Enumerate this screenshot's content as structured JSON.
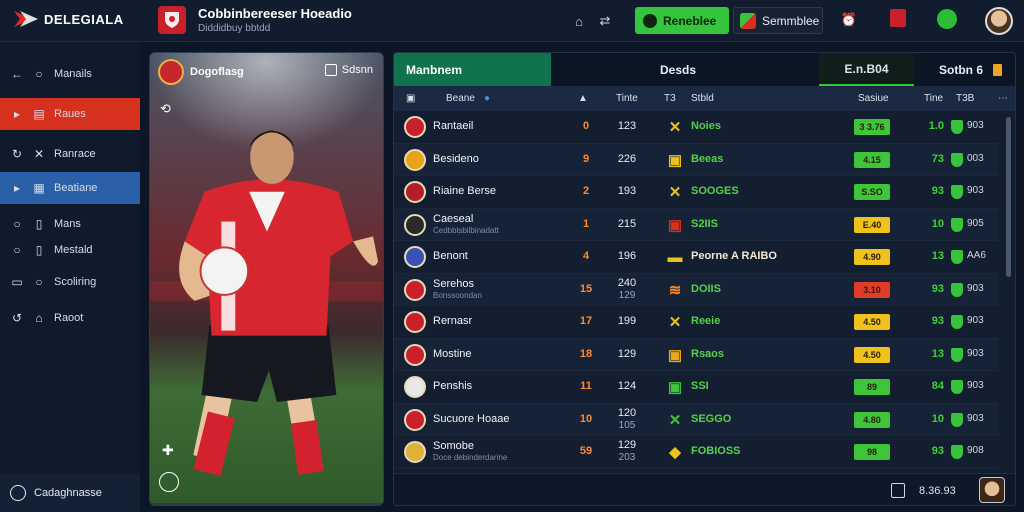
{
  "app": {
    "brand": "DELEGIALA",
    "club_title": "Cobbinbereeser Hoeadio",
    "club_subtitle": "Diddidbuy bbtdd"
  },
  "topbar": {
    "primary_button": "Reneblee",
    "secondary_button": "Semmblee"
  },
  "sidebar": {
    "items": [
      {
        "label": "Manails",
        "icon": "search-icon"
      },
      {
        "label": "Raues",
        "icon": "list-icon"
      },
      {
        "label": "Ranrace",
        "icon": "tools-icon"
      },
      {
        "label": "Beatiane",
        "icon": "calendar-icon"
      },
      {
        "label": "Mans",
        "icon": "doc-icon"
      },
      {
        "label": "Mestald",
        "icon": "doc-icon"
      },
      {
        "label": "Scoliring",
        "icon": "search-icon"
      },
      {
        "label": "Raoot",
        "icon": "tag-icon"
      }
    ],
    "footer": "Cadaghnasse"
  },
  "player_card": {
    "header_name": "Dogoflasg",
    "button": "Sdsnn"
  },
  "panel": {
    "tab_active": "Manbnem",
    "tab_mid": "Desds",
    "tab_score": "E.n.B04",
    "tab_sort": "Sotbn 6",
    "headers": {
      "team": "Beane",
      "pos": "Aa",
      "pts": "Tinte",
      "c1": "T3",
      "result": "Stbld",
      "form": "Sasiue",
      "gd": "Tine",
      "last": "T3B"
    },
    "rows": [
      {
        "team": "Rantaeil",
        "pos": "0",
        "pts": "123",
        "pts_sub": "",
        "result": "Noies",
        "form": "3 3.76",
        "gd": "1.0",
        "last": "903"
      },
      {
        "team": "Besideno",
        "pos": "9",
        "pts": "226",
        "pts_sub": "",
        "result": "Beeas",
        "form": "4.15",
        "gd": "73",
        "last": "003"
      },
      {
        "team": "Riaine Berse",
        "pos": "2",
        "pts": "193",
        "pts_sub": "",
        "result": "SOOGES",
        "form": "S.SO",
        "gd": "93",
        "last": "903"
      },
      {
        "team": "Caeseal",
        "team_sub": "Cedbblsbilbinadatt",
        "pos": "1",
        "pts": "215",
        "pts_sub": "",
        "result": "S2IIS",
        "form": "E.40",
        "gd": "10",
        "last": "905"
      },
      {
        "team": "Benont",
        "pos": "4",
        "pts": "196",
        "pts_sub": "",
        "result": "Peorne A RAIBO",
        "form": "4.90",
        "gd": "13",
        "last": "AA6"
      },
      {
        "team": "Serehos",
        "team_sub": "Bonssoondan",
        "pos": "15",
        "pts": "240",
        "pts_sub": "129",
        "result": "DOIIS",
        "form": "3.10",
        "gd": "93",
        "last": "903"
      },
      {
        "team": "Rernasr",
        "pos": "17",
        "pts": "199",
        "pts_sub": "",
        "result": "Reeie",
        "form": "4.50",
        "gd": "93",
        "last": "903"
      },
      {
        "team": "Mostine",
        "pos": "18",
        "pts": "129",
        "pts_sub": "",
        "result": "Rsaos",
        "form": "4.50",
        "gd": "13",
        "last": "903"
      },
      {
        "team": "Penshis",
        "pos": "11",
        "pts": "124",
        "pts_sub": "",
        "result": "SSI",
        "form": "89",
        "gd": "84",
        "last": "903"
      },
      {
        "team": "Sucuore Hoaae",
        "pos": "10",
        "pts": "120",
        "pts_sub": "105",
        "result": "SEGGO",
        "form": "4.80",
        "gd": "10",
        "last": "903"
      },
      {
        "team": "Somobe",
        "team_sub": "Doce debinderdarine",
        "pos": "59",
        "pts": "129",
        "pts_sub": "203",
        "result": "FOBIOSS",
        "form": "98",
        "gd": "93",
        "last": "908"
      }
    ],
    "footer_text": "8.36.93"
  },
  "colors": {
    "accent_green": "#36c43c",
    "nav_red": "#d6301f",
    "nav_blue": "#2b5fa8",
    "pill_green": "#3ec53a",
    "pill_yellow": "#f0c21e"
  }
}
